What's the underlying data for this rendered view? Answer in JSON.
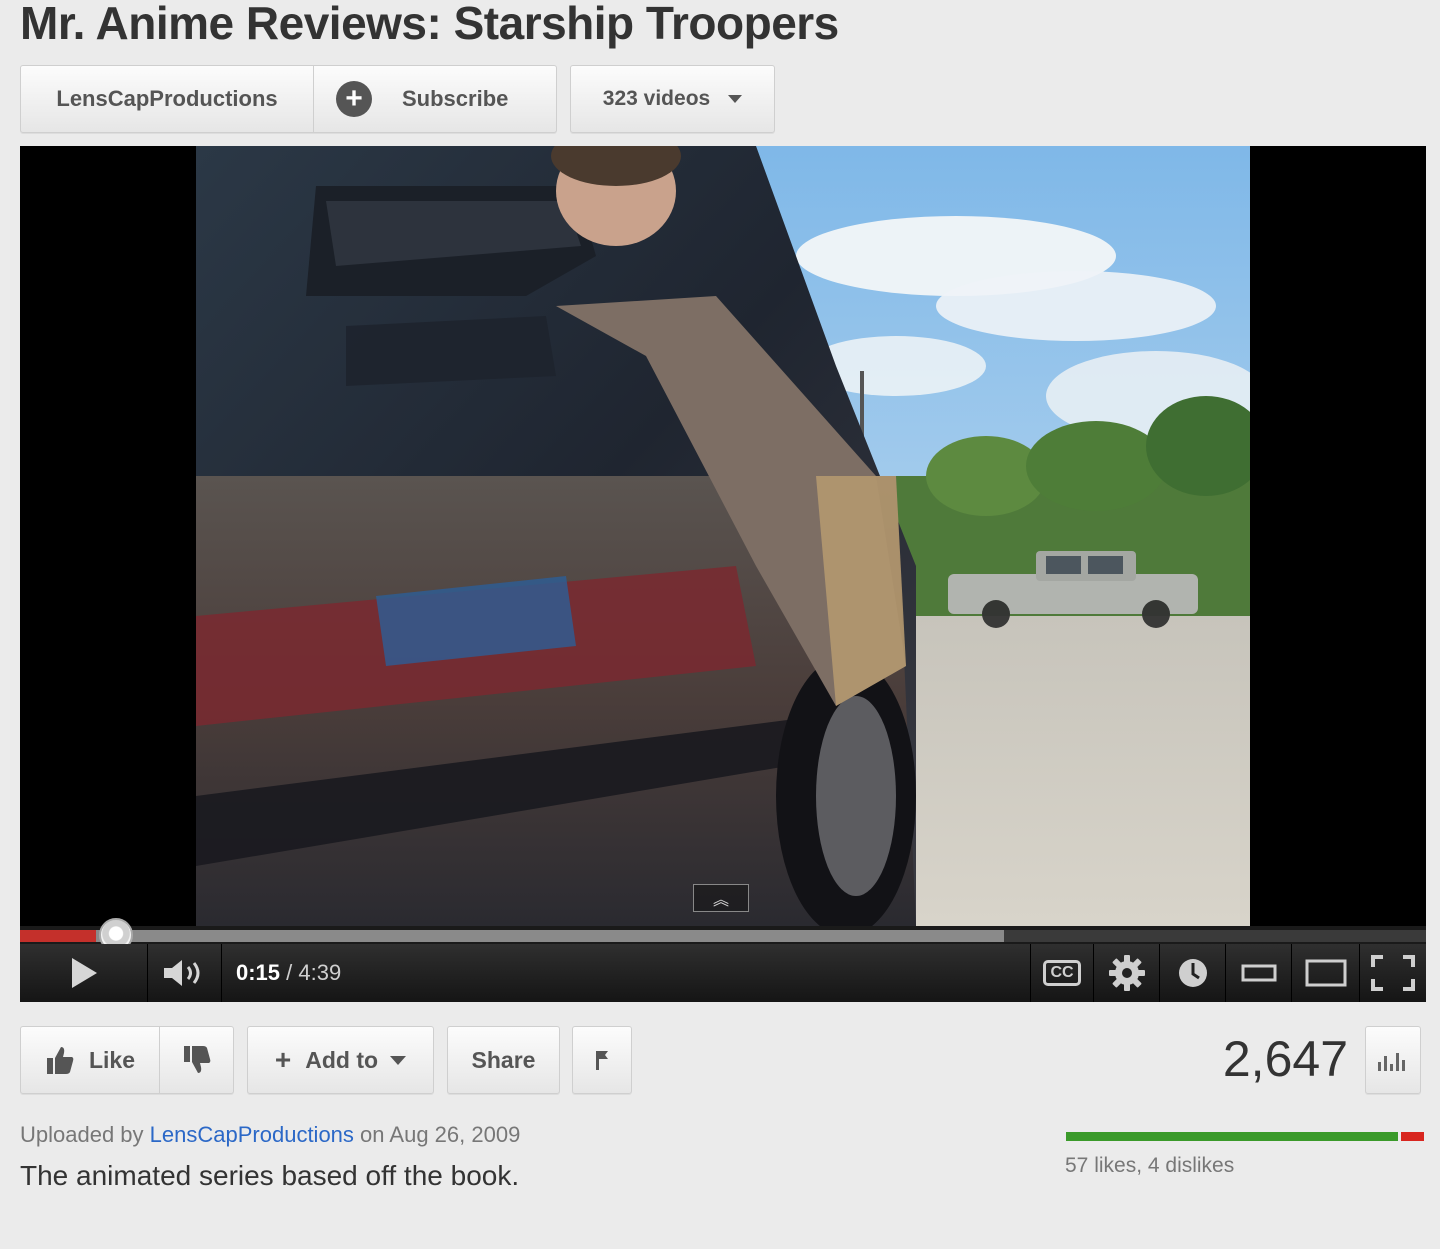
{
  "video": {
    "title": "Mr. Anime Reviews: Starship Troopers",
    "channel_name": "LensCapProductions",
    "subscribe_label": "Subscribe",
    "videos_label": "323 videos"
  },
  "player": {
    "current_time": "0:15",
    "duration": "/ 4:39",
    "progress_fraction": 0.054,
    "buffered_fraction": 0.7,
    "cc_label": "CC",
    "expand_hint": "︽"
  },
  "actions": {
    "like_label": "Like",
    "add_to_label": "Add to",
    "share_label": "Share",
    "view_count": "2,647"
  },
  "meta": {
    "uploaded_prefix": "Uploaded by",
    "uploader": "LensCapProductions",
    "uploaded_on": "on Aug 26, 2009",
    "description": "The animated series based off the book.",
    "likes_summary": "57 likes, 4 dislikes",
    "likes": 57,
    "dislikes": 4
  },
  "colors": {
    "progress_played": "#c4302b",
    "link_blue": "#2b68c7",
    "likes_green": "#3a9a2a",
    "dislikes_red": "#d8261f"
  }
}
